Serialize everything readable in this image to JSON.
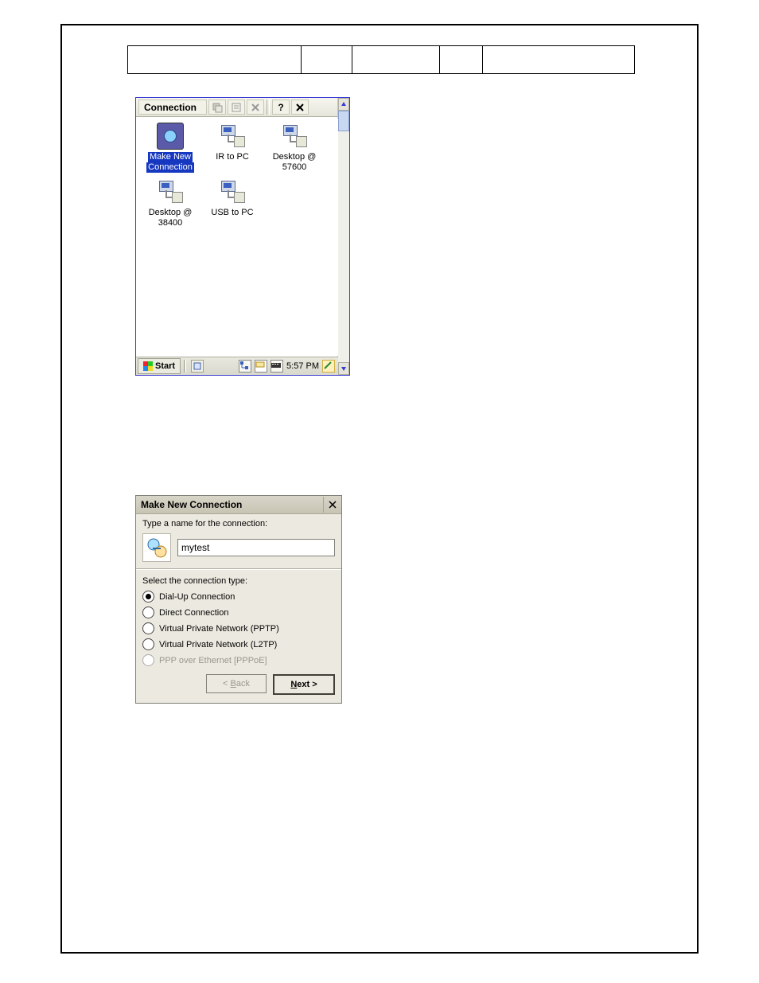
{
  "window1": {
    "toolbar_label": "Connection",
    "icons": [
      {
        "label_line1": "Make New",
        "label_line2": "Connection",
        "selected": true,
        "type": "globe"
      },
      {
        "label_line1": "IR to PC",
        "label_line2": "",
        "type": "net"
      },
      {
        "label_line1": "Desktop @",
        "label_line2": "57600",
        "type": "net"
      },
      {
        "label_line1": "Desktop @",
        "label_line2": "38400",
        "type": "net"
      },
      {
        "label_line1": "USB to PC",
        "label_line2": "",
        "type": "net"
      }
    ],
    "taskbar": {
      "start": "Start",
      "clock": "5:57 PM"
    }
  },
  "window2": {
    "title": "Make New Connection",
    "prompt_name": "Type a name for the connection:",
    "name_value": "mytest",
    "prompt_type": "Select the connection type:",
    "options": {
      "dialup": "Dial-Up Connection",
      "direct": "Direct Connection",
      "pptp": "Virtual Private Network (PPTP)",
      "l2tp": "Virtual Private Network (L2TP)",
      "pppoe": "PPP over Ethernet [PPPoE]"
    },
    "buttons": {
      "back_prefix": "< ",
      "back_letter": "B",
      "back_rest": "ack",
      "next_letter": "N",
      "next_rest": "ext >"
    }
  }
}
